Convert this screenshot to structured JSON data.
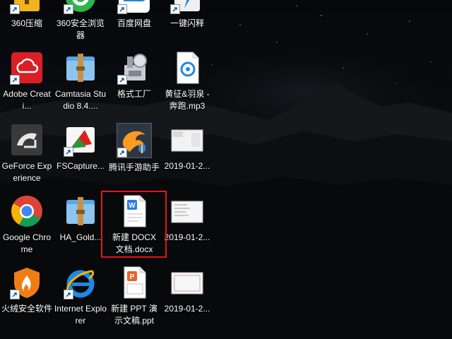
{
  "desktop": {
    "icons": [
      {
        "label": "360压缩",
        "icon": "zip-archive-icon",
        "shortcut": true
      },
      {
        "label": "360安全浏览器",
        "icon": "browser-360-icon",
        "shortcut": true
      },
      {
        "label": "百度网盘",
        "icon": "baidu-netdisk-icon",
        "shortcut": true
      },
      {
        "label": "一键闪释",
        "icon": "lightning-icon",
        "shortcut": true
      },
      {
        "label": "Adobe Creati...",
        "icon": "creative-cloud-icon",
        "shortcut": true
      },
      {
        "label": "Camtasia Studio 8.4....",
        "icon": "folder-archive-icon",
        "shortcut": false
      },
      {
        "label": "格式工厂",
        "icon": "format-factory-icon",
        "shortcut": true
      },
      {
        "label": "黄征&羽泉 - 奔跑.mp3",
        "icon": "audio-file-icon",
        "shortcut": false
      },
      {
        "label": "GeForce Experience",
        "icon": "nvidia-geforce-icon",
        "shortcut": false
      },
      {
        "label": "FSCapture...",
        "icon": "faststone-capture-icon",
        "shortcut": true
      },
      {
        "label": "腾讯手游助手",
        "icon": "tencent-game-assistant-icon",
        "shortcut": true
      },
      {
        "label": "2019-01-2...",
        "icon": "screenshot-thumbnail-icon",
        "shortcut": false
      },
      {
        "label": "Google Chrome",
        "icon": "chrome-icon",
        "shortcut": false
      },
      {
        "label": "HA_Gold...",
        "icon": "folder-archive-icon",
        "shortcut": false
      },
      {
        "label": "新建 DOCX 文档.docx",
        "icon": "docx-file-icon",
        "shortcut": false
      },
      {
        "label": "2019-01-2...",
        "icon": "screenshot-thumbnail-icon",
        "shortcut": false
      },
      {
        "label": "火绒安全软件",
        "icon": "huorong-shield-icon",
        "shortcut": true
      },
      {
        "label": "Internet Explorer",
        "icon": "internet-explorer-icon",
        "shortcut": true
      },
      {
        "label": "新建 PPT 演示文稿.ppt",
        "icon": "ppt-file-icon",
        "shortcut": false
      },
      {
        "label": "2019-01-2...",
        "icon": "screenshot-thumbnail-icon",
        "shortcut": false
      }
    ],
    "selected_icon": "新建 DOCX 文档.docx"
  },
  "colors": {
    "sky_top": "#090b10",
    "mountains": "#181a1d",
    "selection_border": "#e5141b",
    "label_text": "#ffffff"
  }
}
